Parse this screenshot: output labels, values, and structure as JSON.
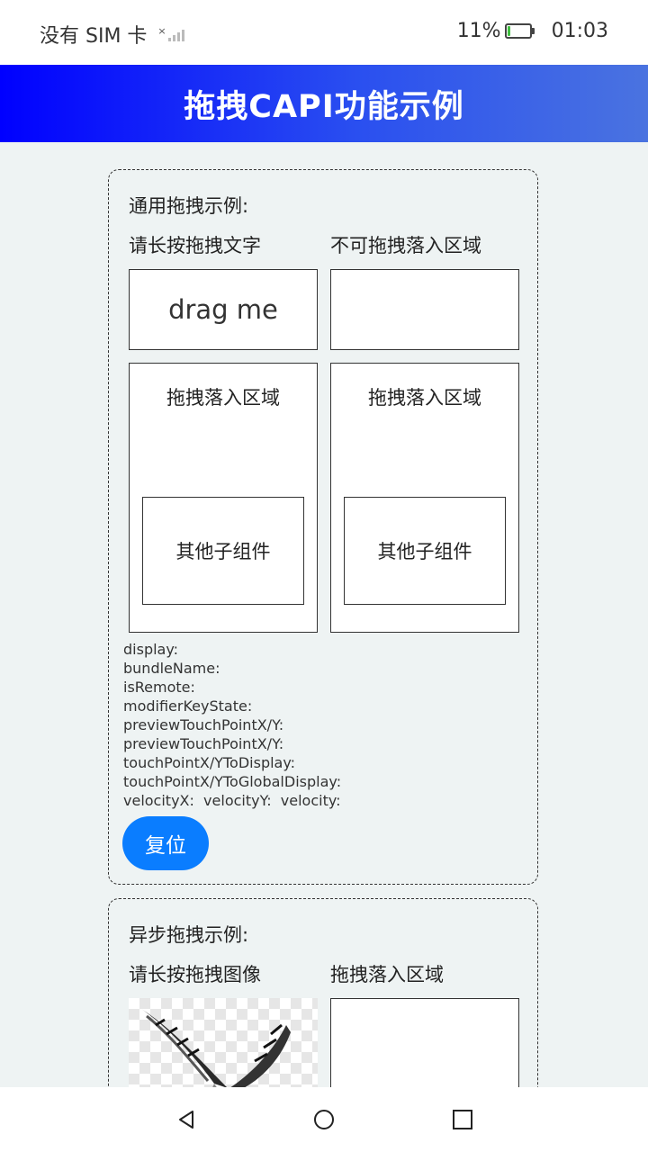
{
  "status_bar": {
    "carrier": "没有 SIM 卡",
    "battery": "11%",
    "battery_level": 0.11,
    "time": "01:03"
  },
  "header": {
    "title": "拖拽CAPI功能示例"
  },
  "card1": {
    "heading": "通用拖拽示例:",
    "left_label": "请长按拖拽文字",
    "right_label": "不可拖拽落入区域",
    "drag_text": "drag me",
    "drop_area_left": "拖拽落入区域",
    "drop_area_right": "拖拽落入区域",
    "child_left": "其他子组件",
    "child_right": "其他子组件",
    "info": [
      "display:",
      "bundleName:",
      "isRemote:",
      "modifierKeyState:",
      "previewTouchPointX/Y:",
      "previewTouchPointX/Y:",
      "touchPointX/YToDisplay:",
      "touchPointX/YToGlobalDisplay:",
      "velocityX:  velocityY:  velocity:"
    ],
    "reset_label": "复位"
  },
  "card2": {
    "heading": "异步拖拽示例:",
    "left_label": "请长按拖拽图像",
    "right_label": "拖拽落入区域"
  },
  "colors": {
    "accent": "#0a7dff",
    "header_gradient_start": "#0000ff",
    "header_gradient_end": "#4a73e0",
    "background": "#eef3f3"
  }
}
